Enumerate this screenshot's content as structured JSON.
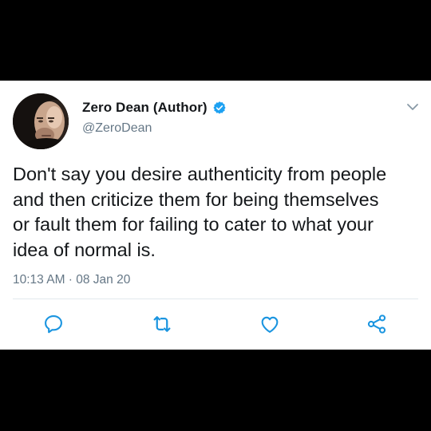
{
  "tweet": {
    "author": {
      "display_name": "Zero Dean (Author)",
      "handle": "@ZeroDean",
      "verified": true,
      "avatar_icon": "profile-photo"
    },
    "text_lines": [
      "Don't say you desire authenticity from people",
      "and then criticize them for being themselves",
      "or fault them for failing to cater to what your",
      "idea of normal is."
    ],
    "timestamp": "10:13 AM · 08 Jan 20"
  },
  "actions": [
    {
      "name": "reply",
      "icon": "comment-icon"
    },
    {
      "name": "retweet",
      "icon": "retweet-icon"
    },
    {
      "name": "like",
      "icon": "heart-icon"
    },
    {
      "name": "share",
      "icon": "share-icon"
    }
  ],
  "colors": {
    "background": "#000000",
    "card": "#ffffff",
    "text_primary": "#14171a",
    "text_secondary": "#657786",
    "verified_blue": "#1da1f2",
    "icon_blue": "#1b95e0",
    "divider": "#e1e8ed"
  }
}
